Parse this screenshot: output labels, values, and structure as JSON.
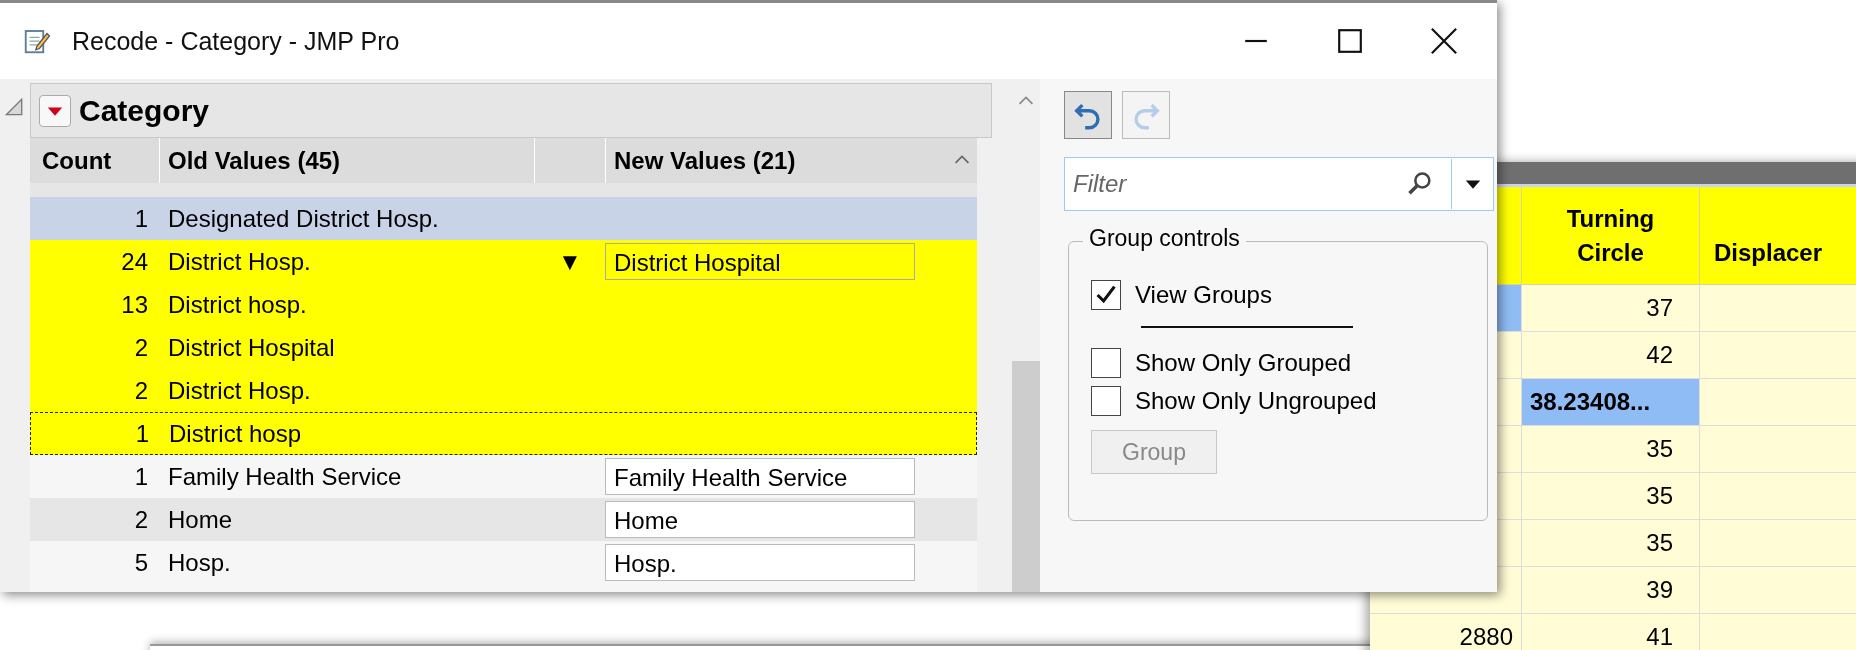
{
  "window": {
    "title": "Recode - Category - JMP Pro"
  },
  "report": {
    "title": "Category",
    "columns": [
      "Count",
      "Old Values (45)",
      "New Values (21)"
    ],
    "rows": [
      {
        "count": "1",
        "old": "Designated District Hosp.",
        "selected": true,
        "grouped": false,
        "focused": false
      },
      {
        "count": "24",
        "old": "District Hosp.",
        "marker": "▼",
        "new": "District Hospital",
        "selected": false,
        "grouped": true,
        "focused": false
      },
      {
        "count": "13",
        "old": "District hosp.",
        "selected": false,
        "grouped": true,
        "focused": false
      },
      {
        "count": "2",
        "old": "District Hospital",
        "selected": false,
        "grouped": true,
        "focused": false
      },
      {
        "count": "2",
        "old": "District Hosp.",
        "selected": false,
        "grouped": true,
        "focused": false
      },
      {
        "count": "1",
        "old": "District hosp",
        "selected": false,
        "grouped": true,
        "focused": true
      },
      {
        "count": "1",
        "old": "Family Health Service",
        "new": "Family Health Service",
        "selected": false,
        "grouped": false,
        "focused": false
      },
      {
        "count": "2",
        "old": "Home",
        "new": "Home",
        "selected": false,
        "grouped": false,
        "focused": false
      },
      {
        "count": "5",
        "old": "Hosp.",
        "new": "Hosp.",
        "selected": false,
        "grouped": false,
        "focused": false
      }
    ]
  },
  "toolbar": {
    "undo_disabled": false,
    "redo_disabled": true
  },
  "filter": {
    "placeholder": "Filter"
  },
  "group_controls": {
    "title": "Group controls",
    "options": [
      {
        "label": "View Groups",
        "checked": true
      },
      {
        "label": "Show Only Grouped",
        "checked": false
      },
      {
        "label": "Show Only Ungrouped",
        "checked": false
      }
    ],
    "button": {
      "label": "Group",
      "disabled": true
    }
  },
  "data_table": {
    "columns": [
      "Turning Circle",
      "Displacer"
    ],
    "rows": [
      {
        "turning_circle": "37",
        "column_1_selected": true,
        "turning_circle_selected": false
      },
      {
        "turning_circle": "42",
        "column_1_selected": false,
        "turning_circle_selected": false
      },
      {
        "turning_circle": "38.23408...",
        "column_1_selected": false,
        "turning_circle_selected": true
      },
      {
        "turning_circle": "35",
        "column_1_selected": false,
        "turning_circle_selected": false
      },
      {
        "turning_circle": "35",
        "column_1_selected": false,
        "turning_circle_selected": false
      },
      {
        "turning_circle": "35",
        "column_1_selected": false,
        "turning_circle_selected": false
      },
      {
        "turning_circle": "39",
        "column_1_selected": false,
        "turning_circle_selected": false
      },
      {
        "column_1": "2880",
        "turning_circle": "41",
        "column_1_selected": false,
        "turning_circle_selected": false
      }
    ]
  }
}
